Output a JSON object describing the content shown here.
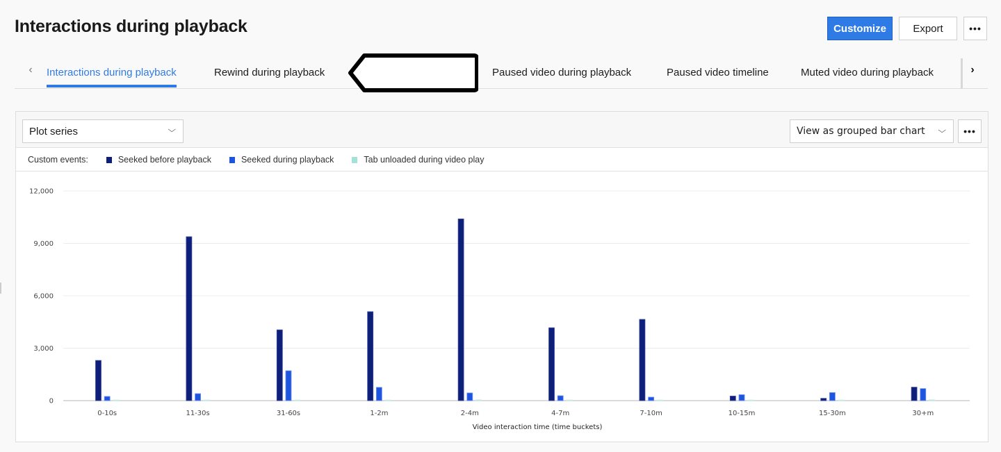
{
  "header": {
    "title": "Interactions during playback",
    "actions": {
      "customize_label": "Customize",
      "export_label": "Export",
      "more_label": "•••"
    }
  },
  "tabs": {
    "prev_icon": "‹",
    "next_icon": "›",
    "items": [
      {
        "label": "Interactions during playback",
        "active": true
      },
      {
        "label": "Rewind during playback",
        "active": false
      },
      {
        "label": "",
        "active": false,
        "redacted": true
      },
      {
        "label": "Paused video during playback",
        "active": false
      },
      {
        "label": "Paused video timeline",
        "active": false
      },
      {
        "label": "Muted video during playback",
        "active": false
      }
    ]
  },
  "panel": {
    "plot_series_select": {
      "value": "Plot series",
      "icon": "⌄"
    },
    "view_select": {
      "value": "View as grouped bar chart",
      "icon": "⌄"
    },
    "more_label": "•••",
    "legend_title": "Custom events:"
  },
  "colors": {
    "accent": "#2f7be5",
    "series_dark": "#0e1f7a",
    "series_blue": "#1e55e0",
    "series_teal": "#a4e2d8"
  },
  "chart_data": {
    "type": "bar",
    "title": "",
    "xlabel": "Video interaction time (time buckets)",
    "ylabel": "",
    "ylim": [
      0,
      12000
    ],
    "yticks": [
      0,
      3000,
      6000,
      9000,
      12000
    ],
    "ytick_labels": [
      "0",
      "3,000",
      "6,000",
      "9,000",
      "12,000"
    ],
    "grid": true,
    "legend_position": "top-left",
    "categories": [
      "0-10s",
      "11-30s",
      "31-60s",
      "1-2m",
      "2-4m",
      "4-7m",
      "7-10m",
      "10-15m",
      "15-30m",
      "30+m"
    ],
    "series": [
      {
        "name": "Seeked before playback",
        "color": "#0e1f7a",
        "values": [
          2300,
          9380,
          4050,
          5090,
          10400,
          4170,
          4650,
          260,
          130,
          770
        ]
      },
      {
        "name": "Seeked during playback",
        "color": "#1e55e0",
        "values": [
          240,
          400,
          1710,
          760,
          440,
          280,
          200,
          340,
          460,
          690
        ]
      },
      {
        "name": "Tab unloaded during video play",
        "color": "#a4e2d8",
        "values": [
          30,
          15,
          20,
          20,
          50,
          20,
          10,
          10,
          10,
          50
        ]
      }
    ]
  }
}
